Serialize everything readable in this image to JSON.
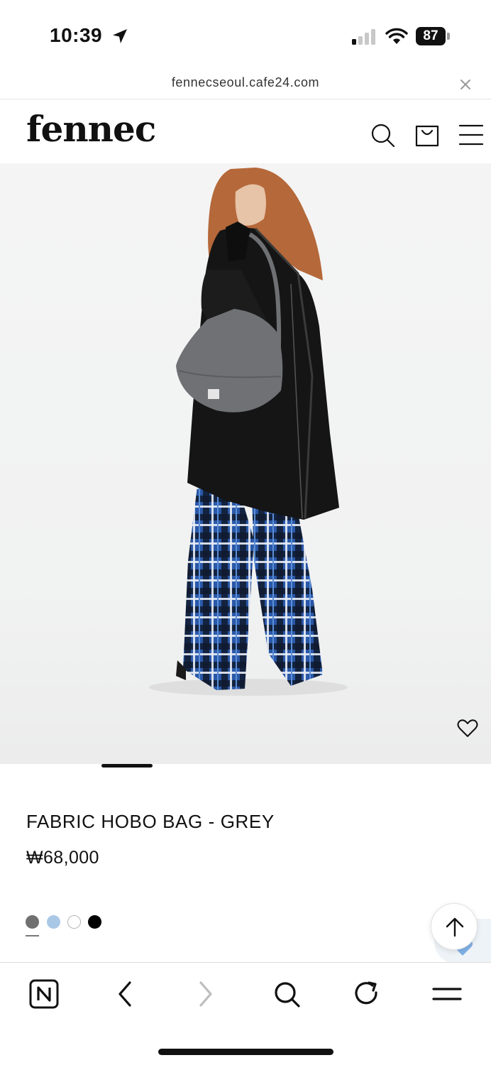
{
  "status_bar": {
    "time": "10:39",
    "battery": "87",
    "icons": [
      "location-arrow-icon",
      "cellular-signal-icon",
      "wifi-icon",
      "battery-icon"
    ]
  },
  "browser": {
    "url": "fennecseoul.cafe24.com",
    "close_icon": "close-icon"
  },
  "header": {
    "logo": "fennec",
    "icons": [
      "search-icon",
      "shopping-bag-icon",
      "menu-icon"
    ]
  },
  "hero": {
    "wishlist_icon": "heart-icon",
    "slide_position": 1
  },
  "product": {
    "name": "FABRIC HOBO BAG - GREY",
    "price": "₩68,000",
    "swatches": [
      {
        "color": "#707070",
        "selected": true
      },
      {
        "color": "#a9c8e6",
        "selected": false
      },
      {
        "color": "#ffffff",
        "selected": false
      },
      {
        "color": "#000000",
        "selected": false
      }
    ]
  },
  "floating": {
    "scroll_top_icon": "arrow-up-icon"
  },
  "toolbar": {
    "items": [
      "naver-home-icon",
      "back-icon",
      "forward-icon",
      "search-icon",
      "reload-icon",
      "menu-icon"
    ]
  }
}
